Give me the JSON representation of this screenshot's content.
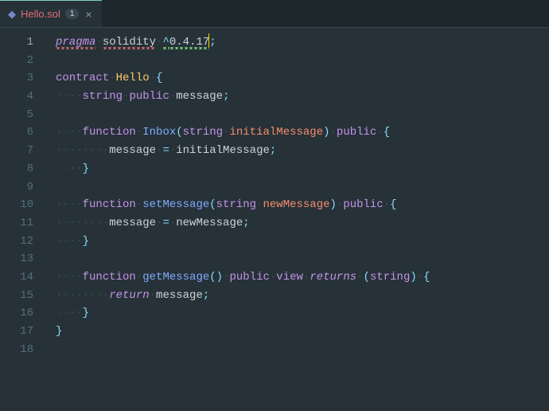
{
  "tab": {
    "filename": "Hello.sol",
    "badge": "1",
    "close": "×",
    "icon": "◆"
  },
  "gutter": {
    "lines": [
      "1",
      "2",
      "3",
      "4",
      "5",
      "6",
      "7",
      "8",
      "9",
      "10",
      "11",
      "12",
      "13",
      "14",
      "15",
      "16",
      "17",
      "18"
    ],
    "active": 0
  },
  "code": {
    "lines": [
      [
        {
          "cls": "tok-keyword squiggle",
          "t": "pragma"
        },
        {
          "cls": "ws",
          "t": "·"
        },
        {
          "cls": "tok-default squiggle",
          "t": "solidity"
        },
        {
          "cls": "ws",
          "t": "·"
        },
        {
          "cls": "tok-punc squiggle-g",
          "t": "^"
        },
        {
          "cls": "tok-default squiggle-g",
          "t": "0.4.17"
        },
        {
          "cls": "cursor",
          "t": ""
        },
        {
          "cls": "tok-punc",
          "t": ";"
        }
      ],
      [],
      [
        {
          "cls": "tok-keyword-ni",
          "t": "contract"
        },
        {
          "cls": "ws",
          "t": "·"
        },
        {
          "cls": "tok-type",
          "t": "Hello"
        },
        {
          "cls": "ws",
          "t": "·"
        },
        {
          "cls": "tok-punc",
          "t": "{"
        }
      ],
      [
        {
          "cls": "ws",
          "t": "····"
        },
        {
          "cls": "tok-keyword-ni",
          "t": "string"
        },
        {
          "cls": "ws",
          "t": "·"
        },
        {
          "cls": "tok-keyword-ni",
          "t": "public"
        },
        {
          "cls": "ws",
          "t": "·"
        },
        {
          "cls": "tok-default",
          "t": "message"
        },
        {
          "cls": "tok-punc",
          "t": ";"
        }
      ],
      [],
      [
        {
          "cls": "ws",
          "t": "····"
        },
        {
          "cls": "tok-keyword-ni",
          "t": "function"
        },
        {
          "cls": "ws",
          "t": "·"
        },
        {
          "cls": "tok-ident",
          "t": "Inbox"
        },
        {
          "cls": "tok-punc",
          "t": "("
        },
        {
          "cls": "tok-keyword-ni",
          "t": "string"
        },
        {
          "cls": "ws",
          "t": "·"
        },
        {
          "cls": "tok-param",
          "t": "initialMessage"
        },
        {
          "cls": "tok-punc",
          "t": ")"
        },
        {
          "cls": "ws",
          "t": "·"
        },
        {
          "cls": "tok-keyword-ni",
          "t": "public"
        },
        {
          "cls": "ws",
          "t": "·"
        },
        {
          "cls": "tok-punc",
          "t": "{"
        }
      ],
      [
        {
          "cls": "ws",
          "t": "········"
        },
        {
          "cls": "tok-default",
          "t": "message"
        },
        {
          "cls": "ws",
          "t": "·"
        },
        {
          "cls": "tok-punc",
          "t": "="
        },
        {
          "cls": "ws",
          "t": "·"
        },
        {
          "cls": "tok-default",
          "t": "initialMessage"
        },
        {
          "cls": "tok-punc",
          "t": ";"
        }
      ],
      [
        {
          "cls": "ws",
          "t": "····"
        },
        {
          "cls": "tok-punc",
          "t": "}"
        }
      ],
      [],
      [
        {
          "cls": "ws",
          "t": "····"
        },
        {
          "cls": "tok-keyword-ni",
          "t": "function"
        },
        {
          "cls": "ws",
          "t": "·"
        },
        {
          "cls": "tok-ident",
          "t": "setMessage"
        },
        {
          "cls": "tok-punc",
          "t": "("
        },
        {
          "cls": "tok-keyword-ni",
          "t": "string"
        },
        {
          "cls": "ws",
          "t": "·"
        },
        {
          "cls": "tok-param",
          "t": "newMessage"
        },
        {
          "cls": "tok-punc",
          "t": ")"
        },
        {
          "cls": "ws",
          "t": "·"
        },
        {
          "cls": "tok-keyword-ni",
          "t": "public"
        },
        {
          "cls": "ws",
          "t": "·"
        },
        {
          "cls": "tok-punc",
          "t": "{"
        }
      ],
      [
        {
          "cls": "ws",
          "t": "········"
        },
        {
          "cls": "tok-default",
          "t": "message"
        },
        {
          "cls": "ws",
          "t": "·"
        },
        {
          "cls": "tok-punc",
          "t": "="
        },
        {
          "cls": "ws",
          "t": "·"
        },
        {
          "cls": "tok-default",
          "t": "newMessage"
        },
        {
          "cls": "tok-punc",
          "t": ";"
        }
      ],
      [
        {
          "cls": "ws",
          "t": "····"
        },
        {
          "cls": "tok-punc",
          "t": "}"
        }
      ],
      [],
      [
        {
          "cls": "ws",
          "t": "····"
        },
        {
          "cls": "tok-keyword-ni",
          "t": "function"
        },
        {
          "cls": "ws",
          "t": "·"
        },
        {
          "cls": "tok-ident",
          "t": "getMessage"
        },
        {
          "cls": "tok-punc",
          "t": "()"
        },
        {
          "cls": "ws",
          "t": "·"
        },
        {
          "cls": "tok-keyword-ni",
          "t": "public"
        },
        {
          "cls": "ws",
          "t": "·"
        },
        {
          "cls": "tok-keyword-ni",
          "t": "view"
        },
        {
          "cls": "ws",
          "t": "·"
        },
        {
          "cls": "tok-keyword",
          "t": "returns"
        },
        {
          "cls": "ws",
          "t": "·"
        },
        {
          "cls": "tok-punc",
          "t": "("
        },
        {
          "cls": "tok-keyword-ni",
          "t": "string"
        },
        {
          "cls": "tok-punc",
          "t": ")"
        },
        {
          "cls": "ws",
          "t": "·"
        },
        {
          "cls": "tok-punc",
          "t": "{"
        }
      ],
      [
        {
          "cls": "ws",
          "t": "········"
        },
        {
          "cls": "tok-keyword",
          "t": "return"
        },
        {
          "cls": "ws",
          "t": "·"
        },
        {
          "cls": "tok-default",
          "t": "message"
        },
        {
          "cls": "tok-punc",
          "t": ";"
        }
      ],
      [
        {
          "cls": "ws",
          "t": "····"
        },
        {
          "cls": "tok-punc",
          "t": "}"
        }
      ],
      [
        {
          "cls": "tok-punc",
          "t": "}"
        }
      ],
      []
    ]
  }
}
